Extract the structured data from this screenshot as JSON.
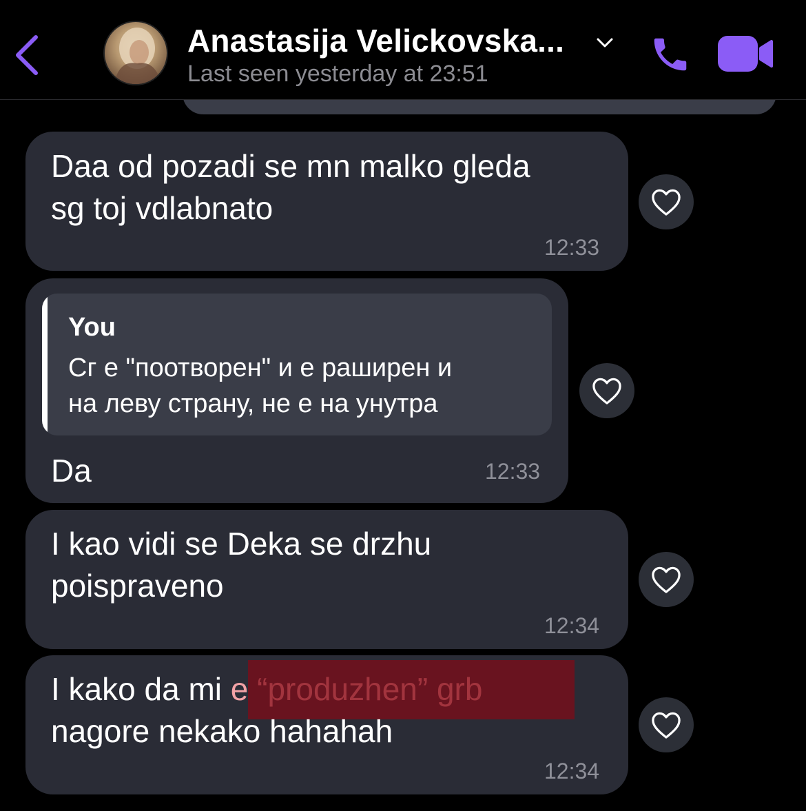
{
  "header": {
    "contact_name": "Anastasija Velickovska...",
    "status": "Last seen yesterday at 23:51",
    "icons": {
      "back": "chevron-left-icon",
      "expand": "chevron-down-icon",
      "call": "phone-icon",
      "video": "video-camera-icon"
    }
  },
  "colors": {
    "accent": "#8b5cf6",
    "bubble_background": "#2a2c36",
    "quote_background": "#3a3d48",
    "timestamp": "#8f9099",
    "highlight": "#820a16"
  },
  "messages": [
    {
      "text": "Daa od pozadi se mn malko gleda\nsg toj vdlabnato",
      "time": "12:33"
    },
    {
      "reply": {
        "author": "You",
        "text": "Сг е \"поотворен\" и е раширен и\nна леву страну, не е на унутра"
      },
      "text": "Da",
      "time": "12:33"
    },
    {
      "text": "I kao vidi se Deka se drzhu\npoispraveno",
      "time": "12:34"
    },
    {
      "text_prefix": "I kako da mi ",
      "text_highlight": "e “produzhen” grb",
      "text_suffix": "nagore nekako hahahah",
      "time": "12:34"
    }
  ],
  "reaction_icon": "heart-outline-icon"
}
